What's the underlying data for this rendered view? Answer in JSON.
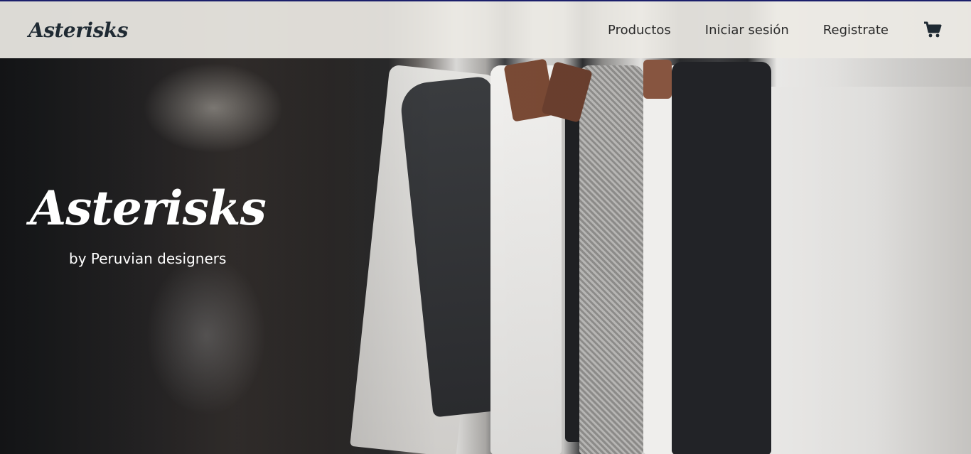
{
  "header": {
    "brand": "Asterisks",
    "nav": [
      {
        "label": "Productos"
      },
      {
        "label": "Iniciar sesión"
      },
      {
        "label": "Registrate"
      }
    ],
    "cart_icon": "cart-icon"
  },
  "hero": {
    "title": "Asterisks",
    "subtitle": "by Peruvian designers",
    "background": "clothing-rack-photo"
  },
  "colors": {
    "header_bg": "#ECEAE4",
    "brand_text": "#1F2A33",
    "hero_text": "#FFFFFF"
  }
}
